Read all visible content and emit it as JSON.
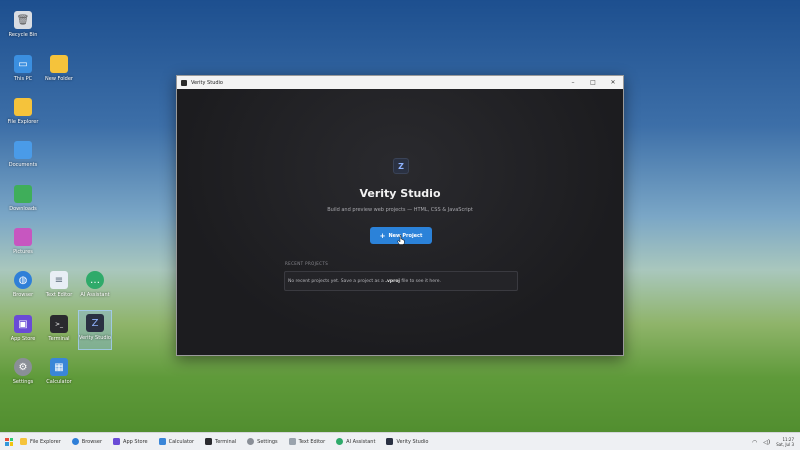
{
  "desktop": {
    "icons": [
      {
        "label": "Recycle Bin",
        "icon": "recycle-bin-icon",
        "color": "#d9dde3"
      },
      {
        "label": "This PC",
        "icon": "monitor-icon",
        "color": "#3b8fe0"
      },
      {
        "label": "New Folder",
        "icon": "folder-icon",
        "color": "#f5c33b"
      },
      {
        "label": "File Explorer",
        "icon": "folder-icon",
        "color": "#f5c33b"
      },
      {
        "label": "Documents",
        "icon": "folder-icon",
        "color": "#4a9be8"
      },
      {
        "label": "Downloads",
        "icon": "folder-icon",
        "color": "#3fae5a"
      },
      {
        "label": "Pictures",
        "icon": "folder-icon",
        "color": "#c756c0"
      },
      {
        "label": "Browser",
        "icon": "globe-icon",
        "color": "#2f7fd8"
      },
      {
        "label": "Text Editor",
        "icon": "document-icon",
        "color": "#e8eef5"
      },
      {
        "label": "AI Assistant",
        "icon": "chat-icon",
        "color": "#2faa6a"
      },
      {
        "label": "App Store",
        "icon": "store-icon",
        "color": "#6a4bd6"
      },
      {
        "label": "Terminal",
        "icon": "terminal-icon",
        "color": "#2a2a2e"
      },
      {
        "label": "Verity Studio",
        "icon": "verity-icon",
        "color": "#2a3142"
      },
      {
        "label": "Settings",
        "icon": "gear-icon",
        "color": "#8a8f97"
      },
      {
        "label": "Calculator",
        "icon": "calculator-icon",
        "color": "#3a86d8"
      }
    ]
  },
  "window": {
    "title": "Verity Studio",
    "controls": {
      "minimize": "–",
      "maximize": "□",
      "close": "✕"
    },
    "app_title": "Verity Studio",
    "app_subtitle": "Build and preview web projects — HTML, CSS & JavaScript",
    "new_project_label": "New Project",
    "recent_heading": "RECENT PROJECTS",
    "recent_empty_prefix": "No recent projects yet. Save a project as a ",
    "recent_empty_ext": ".vproj",
    "recent_empty_suffix": " file to see it here."
  },
  "taskbar": {
    "items": [
      {
        "label": "File Explorer",
        "icon": "folder-icon",
        "color": "#f5c33b"
      },
      {
        "label": "Browser",
        "icon": "globe-icon",
        "color": "#2f7fd8"
      },
      {
        "label": "App Store",
        "icon": "store-icon",
        "color": "#6a4bd6"
      },
      {
        "label": "Calculator",
        "icon": "calculator-icon",
        "color": "#3a86d8"
      },
      {
        "label": "Terminal",
        "icon": "terminal-icon",
        "color": "#2a2a2e"
      },
      {
        "label": "Settings",
        "icon": "gear-icon",
        "color": "#8a8f97"
      },
      {
        "label": "Text Editor",
        "icon": "document-icon",
        "color": "#9aa3ad"
      },
      {
        "label": "AI Assistant",
        "icon": "chat-icon",
        "color": "#2faa6a"
      },
      {
        "label": "Verity Studio",
        "icon": "verity-icon",
        "color": "#2a3142"
      }
    ],
    "clock_time": "11:27",
    "clock_date": "Sat, Jul 3"
  },
  "colors": {
    "accent": "#2b82d9",
    "window_bg": "#1f1f22"
  }
}
